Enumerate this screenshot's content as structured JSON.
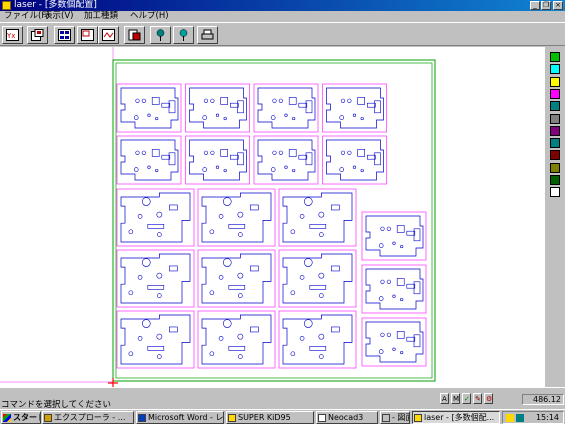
{
  "window": {
    "title": "laser - [多数個配置]"
  },
  "title_buttons": {
    "minimize": "_",
    "restore": "❐",
    "close": "×"
  },
  "menu": {
    "items": [
      "ファイル(F)",
      "表示(V)",
      "加工種類",
      "ヘルプ(H)"
    ]
  },
  "toolbar": {
    "buttons": [
      {
        "name": "yx-button",
        "icon": "yx-axis-icon"
      },
      {
        "name": "layout-button",
        "icon": "layout-icon"
      },
      {
        "name": "grid-array-button",
        "icon": "grid-array-icon"
      },
      {
        "name": "part-view-button",
        "icon": "part-view-icon"
      },
      {
        "name": "cut-path-button",
        "icon": "cut-path-icon"
      },
      {
        "name": "paste-button",
        "icon": "paste-icon"
      },
      {
        "name": "pin-blue-button",
        "icon": "pin-icon"
      },
      {
        "name": "pin-cyan-button",
        "icon": "pin-icon"
      },
      {
        "name": "print-button",
        "icon": "printer-icon"
      }
    ]
  },
  "palette": {
    "colors": [
      "#00c000",
      "#00ffff",
      "#ffff00",
      "#ff00ff",
      "#008080",
      "#808080",
      "#800080",
      "#008080",
      "#800000",
      "#808000",
      "#006000",
      "#ffffff"
    ]
  },
  "status": {
    "prompt": "コマンドを選択してください",
    "coords": "486.12",
    "status_icons": [
      "A",
      "M",
      "✓",
      "✎",
      "⚙"
    ]
  },
  "taskbar": {
    "start": "スタート",
    "tasks": [
      {
        "label": "エクスプローラ - ...",
        "icon_color": "#d0a000",
        "active": false
      },
      {
        "label": "Microsoft Word - レ...",
        "icon_color": "#0040c0",
        "active": false
      },
      {
        "label": "SUPER KiD95",
        "icon_color": "#ffd800",
        "active": false
      },
      {
        "label": "Neocad3",
        "icon_color": "#ffffff",
        "active": false
      },
      {
        "label": "- 図面",
        "icon_color": "#c0c0c0",
        "active": false
      },
      {
        "label": "laser - [多数個配...",
        "icon_color": "#ffd800",
        "active": true
      }
    ],
    "clock": "15:14"
  },
  "colors": {
    "sheet_outline": "#00a000",
    "part_frame": "#ff44ff",
    "part_geometry": "#0000cc",
    "origin_marker": "#ff0000"
  }
}
